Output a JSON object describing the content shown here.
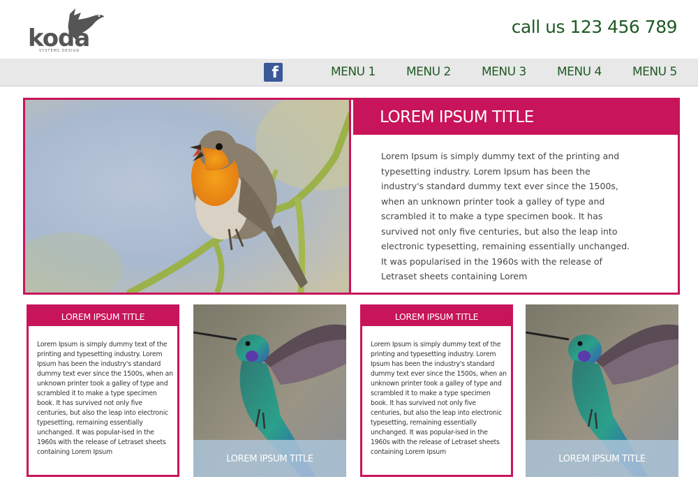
{
  "header": {
    "logo_text": "koda",
    "logo_subtitle": "SYSTEMS DESIGN",
    "phone": "call us 123 456 789"
  },
  "nav": {
    "facebook_icon": "facebook-icon",
    "items": [
      {
        "label": "MENU 1"
      },
      {
        "label": "MENU 2"
      },
      {
        "label": "MENU 3"
      },
      {
        "label": "MENU 4"
      },
      {
        "label": "MENU 5"
      }
    ]
  },
  "hero": {
    "title": "LOREM IPSUM TITLE",
    "text": "Lorem Ipsum is simply dummy text of the printing and typesetting industry. Lorem Ipsum has been the industry's standard dummy text ever since the 1500s, when an unknown printer took a galley of type and scrambled it to make a type specimen book. It has survived not only five centuries, but also the leap into electronic typesetting, remaining essentially unchanged. It was popularised in the 1960s with the release of Letraset sheets containing Lorem",
    "image": "robin-bird-photo"
  },
  "cards": [
    {
      "title": "LOREM IPSUM TITLE",
      "text": "Lorem Ipsum is simply dummy text of the printing and typesetting industry. Lorem Ipsum has been the industry's standard dummy text ever since the 1500s, when an unknown printer took a galley of type and scrambled it to make a type specimen book. It has survived not only five centuries, but also the leap into electronic typesetting, remaining essentially unchanged. It was popular-ised in the 1960s with the release of Letraset sheets containing Lorem Ipsum"
    },
    {
      "caption": "LOREM IPSUM TITLE",
      "image": "hummingbird-photo"
    },
    {
      "title": "LOREM IPSUM TITLE",
      "text": "Lorem Ipsum is simply dummy text of the printing and typesetting industry. Lorem Ipsum has been the industry's standard dummy text ever since the 1500s, when an unknown printer took a galley of type and scrambled it to make a type specimen book. It has survived not only five centuries, but also the leap into electronic typesetting, remaining essentially unchanged. It was popular-ised in the 1960s with the release of Letraset sheets containing Lorem Ipsum"
    },
    {
      "caption": "LOREM IPSUM TITLE",
      "image": "hummingbird-photo"
    }
  ],
  "colors": {
    "accent": "#c8145a",
    "nav_text": "#1f5a24",
    "nav_bg": "#e8e8e8",
    "facebook": "#3b5998"
  }
}
